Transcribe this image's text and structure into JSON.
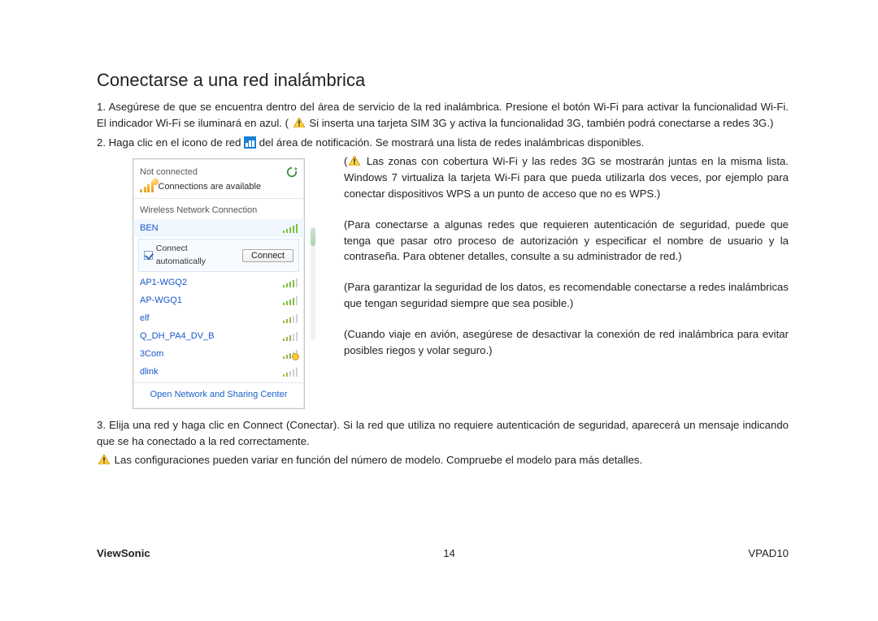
{
  "title": "Conectarse a una red inalámbrica",
  "p1a": "1. Asegúrese de que se encuentra dentro del área de servicio de la red inalámbrica. Presione el botón Wi-Fi para activar la funcionalidad Wi-Fi. El indicador Wi-Fi se iluminará en azul. (",
  "p1b": " Si inserta una tarjeta SIM 3G y activa la funcionalidad 3G, también podrá conectarse a redes 3G.)",
  "p2a": "2. Haga clic en el icono de red ",
  "p2b": " del área de notificación. Se mostrará una lista de redes inalámbricas disponibles.",
  "p3a": "(",
  "p3b": " Las zonas con cobertura Wi-Fi y las redes 3G  se mostrarán juntas en la misma lista. Windows 7 virtualiza la tarjeta Wi-Fi para que pueda utilizarla dos veces, por ejemplo para conectar dispositivos WPS a un punto de acceso que no es WPS.)",
  "p4": "(Para conectarse a algunas redes que requieren autenticación de seguridad, puede que tenga que pasar otro proceso de autorización y especificar el nombre de usuario y la contraseña. Para obtener detalles, consulte a su administrador de red.)",
  "p5": "(Para garantizar la seguridad de los datos, es recomendable conectarse a redes inalámbricas que tengan seguridad siempre que sea posible.)",
  "p6": "(Cuando viaje en avión, asegúrese de desactivar la conexión de red inalámbrica para evitar posibles riegos y volar seguro.)",
  "p7": "3. Elija una red y haga clic en Connect (Conectar). Si la red que utiliza no requiere autenticación de seguridad, aparecerá un mensaje indicando que se ha conectado a la red correctamente.",
  "p8": " Las configuraciones pueden variar en función del número de modelo. Compruebe el modelo para más detalles.",
  "flyout": {
    "not_connected": "Not connected",
    "available": "Connections are available",
    "section": "Wireless Network Connection",
    "auto_label": "Connect automatically",
    "connect_btn": "Connect",
    "footer": "Open Network and Sharing Center",
    "items": [
      {
        "name": "BEN",
        "strength": 5,
        "secure": false
      },
      {
        "name": "AP1-WGQ2",
        "strength": 4,
        "secure": false
      },
      {
        "name": "AP-WGQ1",
        "strength": 4,
        "secure": false
      },
      {
        "name": "elf",
        "strength": 3,
        "secure": false
      },
      {
        "name": "Q_DH_PA4_DV_B",
        "strength": 3,
        "secure": false
      },
      {
        "name": "3Com",
        "strength": 3,
        "secure": true
      },
      {
        "name": "dlink",
        "strength": 2,
        "secure": false
      }
    ]
  },
  "footer": {
    "brand": "ViewSonic",
    "page": "14",
    "model": "VPAD10"
  }
}
